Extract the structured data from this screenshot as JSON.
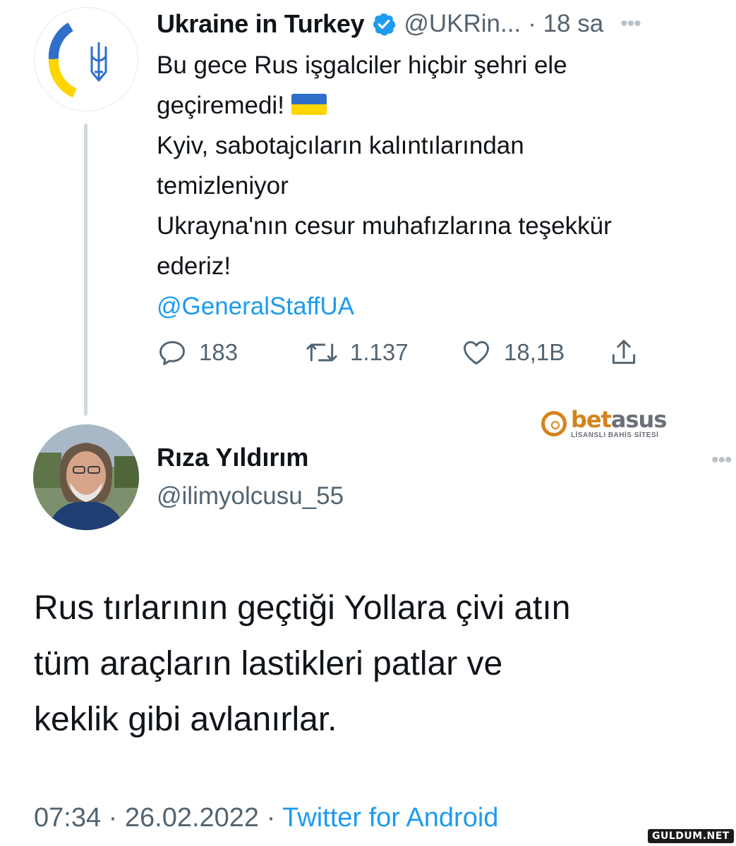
{
  "tweet1": {
    "author_name": "Ukraine in Turkey",
    "verified_icon": "verified-badge-icon",
    "handle": "@UKRin...",
    "time": "· 18 sa",
    "more": "•••",
    "body_lines": [
      "Bu gece Rus işgalciler hiçbir şehri ele",
      "geçiremedi!",
      "Kyiv, sabotajcıların kalıntılarından",
      "temizleniyor",
      "Ukrayna'nın cesur muhafızlarına teşekkür",
      "ederiz!"
    ],
    "mention": "@GeneralStaffUA",
    "flag_colors": {
      "top": "#2f6fc9",
      "bottom": "#ffd500"
    },
    "actions": {
      "reply_count": "183",
      "retweet_count": "1.137",
      "like_count": "18,1B"
    }
  },
  "watermark": {
    "brand_prefix": "bet",
    "brand_suffix": "asus",
    "tagline": "LİSANSLI BAHİS SİTESİ"
  },
  "tweet2": {
    "author_name": "Rıza Yıldırım",
    "handle": "@ilimyolcusu_55",
    "more": "•••",
    "body_lines": [
      "Rus tırlarının geçtiği  Yollara çivi atın",
      "tüm araçların lastikleri patlar ve",
      "keklik gibi avlanırlar."
    ],
    "time": "07:34",
    "date": "26.02.2022",
    "source": "Twitter for Android"
  },
  "site_watermark": "GULDUM.NET",
  "colors": {
    "accent": "#1d9bf0",
    "muted": "#536471",
    "text": "#0f1419"
  }
}
